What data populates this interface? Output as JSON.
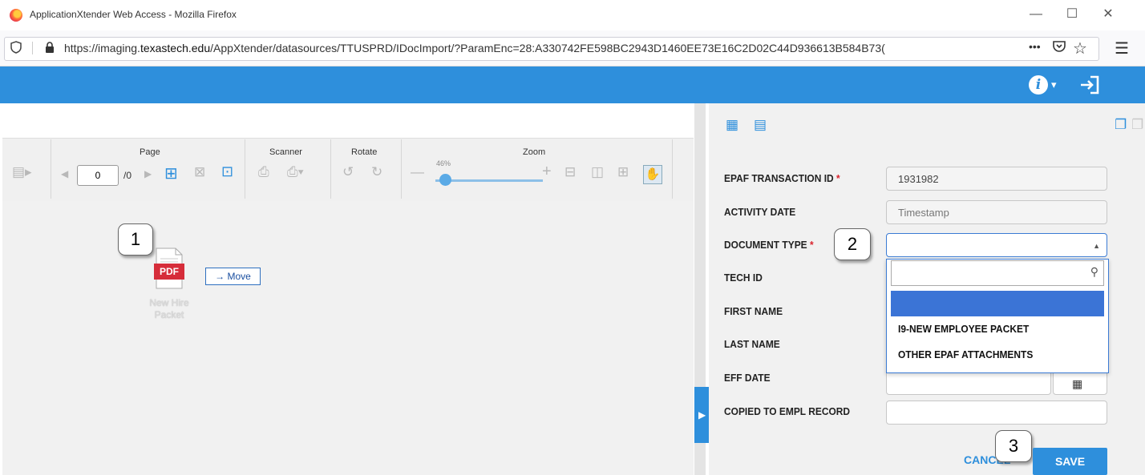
{
  "window": {
    "title": "ApplicationXtender Web Access - Mozilla Firefox",
    "minimize_icon": "minimize-icon",
    "maximize_icon": "maximize-icon",
    "close_icon": "close-icon"
  },
  "browser": {
    "url_prefix": "https://imaging.",
    "url_domain": "texastech.edu",
    "url_rest": "/AppXtender/datasources/TTUSPRD/IDocImport/?ParamEnc=28:A330742FE598BC2943D1460EE73E16C2D02C44D936613B584B73(",
    "more_label": "•••"
  },
  "toolbar": {
    "page_label": "Page",
    "scanner_label": "Scanner",
    "rotate_label": "Rotate",
    "zoom_label": "Zoom",
    "page_value": "0",
    "page_total": "/0",
    "zoom_value": "46%"
  },
  "viewer": {
    "badge1": "1",
    "file_type": "PDF",
    "move_label": "→ Move",
    "file_name_line1": "New Hire",
    "file_name_line2": "Packet"
  },
  "form": {
    "fields": [
      {
        "label": "EPAF TRANSACTION ID",
        "required": true,
        "value": "1931982"
      },
      {
        "label": "ACTIVITY DATE",
        "required": false,
        "value": "Timestamp"
      },
      {
        "label": "DOCUMENT TYPE",
        "required": true,
        "value": ""
      },
      {
        "label": "TECH ID",
        "required": false,
        "value": ""
      },
      {
        "label": "FIRST NAME",
        "required": false,
        "value": ""
      },
      {
        "label": "LAST NAME",
        "required": false,
        "value": ""
      },
      {
        "label": "EFF DATE",
        "required": false,
        "value": ""
      },
      {
        "label": "COPIED TO EMPL RECORD",
        "required": false,
        "value": ""
      }
    ],
    "required_mark": "*",
    "badge2": "2",
    "badge3": "3",
    "dropdown_options": [
      "",
      "I9-NEW EMPLOYEE PACKET",
      "OTHER EPAF ATTACHMENTS"
    ],
    "cancel_label": "CANCEL",
    "save_label": "SAVE"
  },
  "colors": {
    "accent": "#2e8fdc",
    "highlight": "#3b74d6",
    "required": "#d9232d",
    "pdf_red": "#d62d3a"
  }
}
